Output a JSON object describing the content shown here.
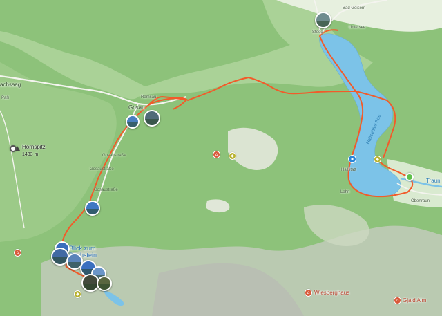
{
  "map": {
    "towns": {
      "gosau": "Gosau",
      "ramsau": "Ramsau",
      "hallstatt": "Hallstatt",
      "obertraun": "Obertraun",
      "bad_goisern": "Bad Goisern",
      "steeg": "Steeg",
      "untersee": "Untersee",
      "lahn": "Lahn",
      "kirchsaag": "achsaag",
      "pass": "Paß",
      "traun": "Traun"
    },
    "road_labels": {
      "gosaustrasse_1": "Gosaustraße",
      "gosaustrasse_2": "Gosaustraße",
      "gosaustrasse_3": "Gosaustraße"
    },
    "peak": {
      "name": "Hornspitz",
      "elevation": "1433 m"
    },
    "lake_name": "Hallstätter See",
    "blue_label": "Blick zum Dachstein",
    "pois": {
      "wiesberghaus": "Wiesberghaus",
      "gjaid_alm": "Gjaid Alm"
    },
    "colors": {
      "forest": "#8dc27a",
      "meadow": "#d6ebc8",
      "lake": "#7cc3e8",
      "route": "#f25b2a",
      "rock": "#c9c9c4"
    }
  }
}
